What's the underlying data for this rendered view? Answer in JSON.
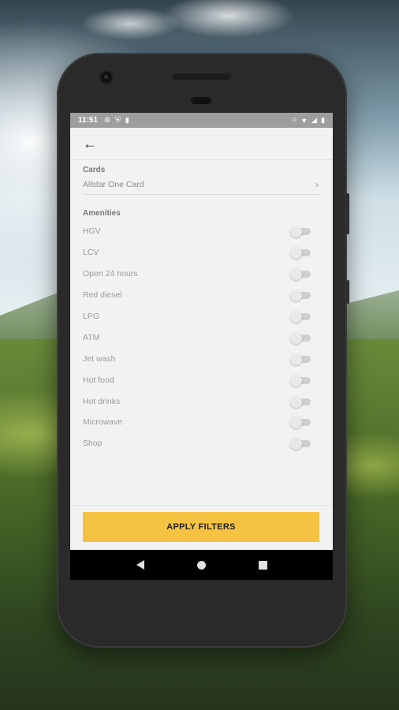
{
  "status_bar": {
    "time": "11:51",
    "left_icons": [
      "gear-icon",
      "shield-icon",
      "sd-card-icon"
    ],
    "right_icons": [
      "location-icon",
      "wifi-icon",
      "signal-icon",
      "battery-icon"
    ]
  },
  "app_bar": {
    "back_icon": "arrow-left-icon"
  },
  "cards": {
    "title": "Cards",
    "selected": "Allstar One Card"
  },
  "amenities": {
    "title": "Amenities",
    "items": [
      {
        "label": "HGV",
        "enabled": false
      },
      {
        "label": "LCV",
        "enabled": false
      },
      {
        "label": "Open 24 hours",
        "enabled": false
      },
      {
        "label": "Red diesel",
        "enabled": false
      },
      {
        "label": "LPG",
        "enabled": false
      },
      {
        "label": "ATM",
        "enabled": false
      },
      {
        "label": "Jet wash",
        "enabled": false
      },
      {
        "label": "Hot food",
        "enabled": false
      },
      {
        "label": "Hot drinks",
        "enabled": false
      },
      {
        "label": "Microwave",
        "enabled": false
      },
      {
        "label": "Shop",
        "enabled": false
      }
    ]
  },
  "apply_button": {
    "label": "APPLY FILTERS"
  },
  "colors": {
    "accent": "#f5c242",
    "status_bar": "#9e9e9e",
    "screen_bg": "#f2f2f2"
  }
}
